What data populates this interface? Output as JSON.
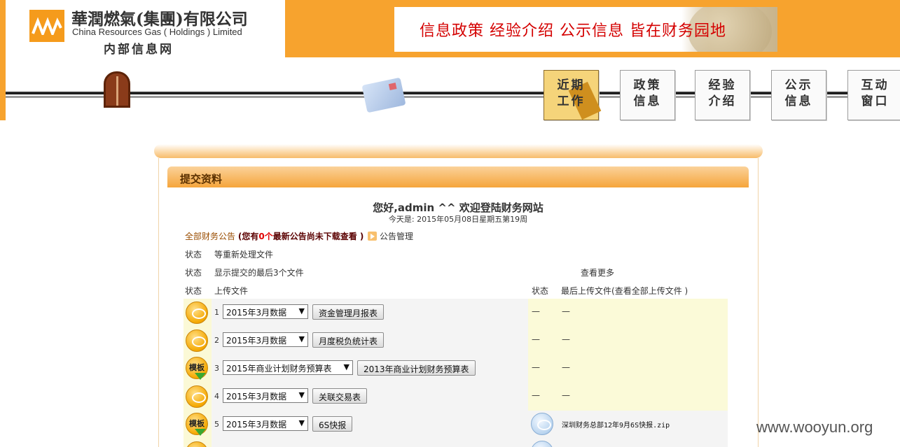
{
  "header": {
    "company_cn": "華潤燃氣(集團)有限公司",
    "company_en": "China Resources Gas ( Holdings ) Limited",
    "site_name": "内部信息网",
    "banner_text": "信息政策 经验介绍 公示信息 皆在财务园地"
  },
  "nav": [
    {
      "line1": "近期",
      "line2": "工作",
      "active": true
    },
    {
      "line1": "政策",
      "line2": "信息",
      "active": false
    },
    {
      "line1": "经验",
      "line2": "介绍",
      "active": false
    },
    {
      "line1": "公示",
      "line2": "信息",
      "active": false
    },
    {
      "line1": "互动",
      "line2": "窗口",
      "active": false
    }
  ],
  "section": {
    "title": "提交资料",
    "welcome": "您好,admin ^^ 欢迎登陆财务网站",
    "today": "今天是: 2015年05月08日星期五第19周"
  },
  "notice": {
    "all_label": "全部财务公告",
    "open": "(您有",
    "count": "0个",
    "rest": "最新公告尚未下载查看 )",
    "manage": "公告管理"
  },
  "labels": {
    "status": "状态",
    "reprocess": "等重新处理文件",
    "show_last": "显示提交的最后3个文件",
    "see_more": "查看更多",
    "upload": "上传文件",
    "last_upload": "最后上传文件",
    "view_all": "(查看全部上传文件 )"
  },
  "rows": [
    {
      "no": "1",
      "icon": "bubble",
      "select": "2015年3月数据",
      "button": "资金管理月报表",
      "extra_button": "",
      "status": "—",
      "last": "—"
    },
    {
      "no": "2",
      "icon": "bubble",
      "select": "2015年3月数据",
      "button": "月度税负统计表",
      "extra_button": "",
      "status": "—",
      "last": "—"
    },
    {
      "no": "3",
      "icon": "template",
      "select": "2015年商业计划财务预算表",
      "button": "",
      "extra_button": "2013年商业计划财务预算表",
      "status": "—",
      "last": "—"
    },
    {
      "no": "4",
      "icon": "bubble",
      "select": "2015年3月数据",
      "button": "关联交易表",
      "extra_button": "",
      "status": "—",
      "last": "—"
    },
    {
      "no": "5",
      "icon": "template",
      "select": "2015年3月数据",
      "button": "6S快报",
      "extra_button": "",
      "status": "mail",
      "last": "深圳财务总部12年9月6S快报.zip"
    }
  ],
  "template_label": "模板",
  "watermark": "www.wooyun.org",
  "colors": {
    "header_orange": "#f7a32e",
    "accent_red": "#d40000"
  }
}
